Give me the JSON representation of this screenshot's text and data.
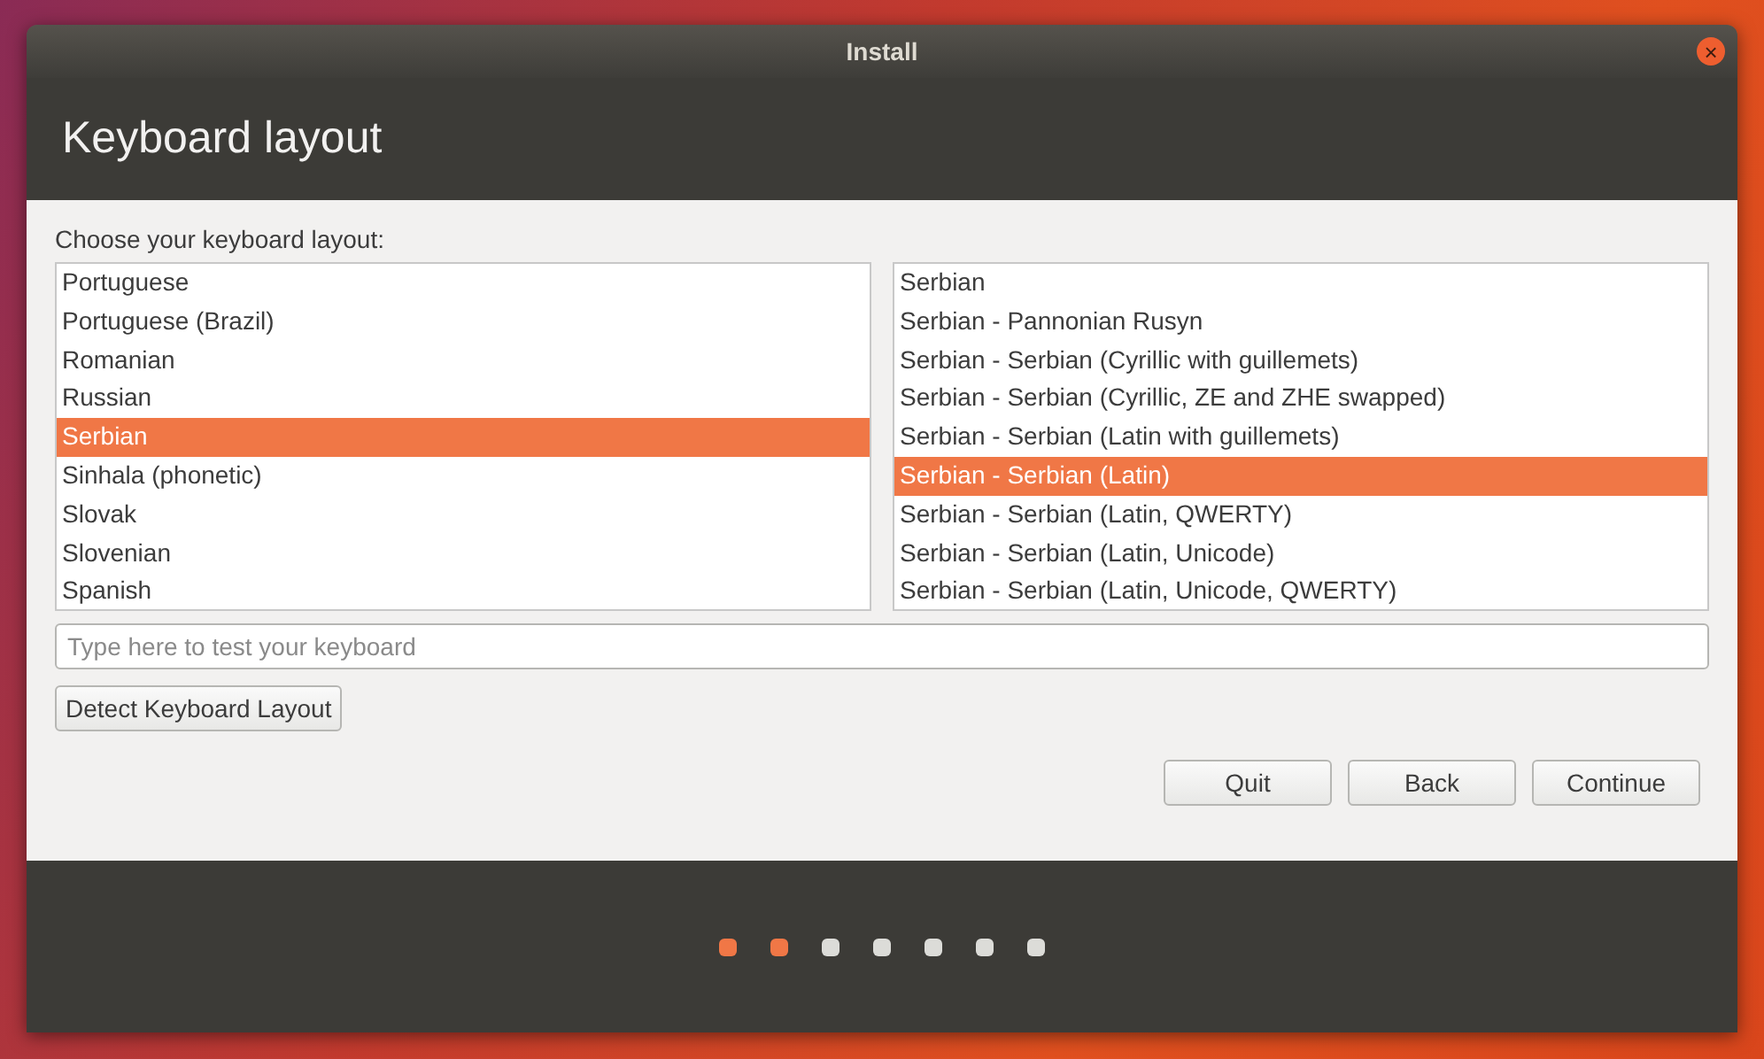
{
  "window": {
    "title": "Install",
    "close": "×"
  },
  "heading": "Keyboard layout",
  "prompt": "Choose your keyboard layout:",
  "layouts": [
    {
      "label": "Portuguese",
      "selected": false
    },
    {
      "label": "Portuguese (Brazil)",
      "selected": false
    },
    {
      "label": "Romanian",
      "selected": false
    },
    {
      "label": "Russian",
      "selected": false
    },
    {
      "label": "Serbian",
      "selected": true
    },
    {
      "label": "Sinhala (phonetic)",
      "selected": false
    },
    {
      "label": "Slovak",
      "selected": false
    },
    {
      "label": "Slovenian",
      "selected": false
    },
    {
      "label": "Spanish",
      "selected": false
    }
  ],
  "variants": [
    {
      "label": "Serbian",
      "selected": false
    },
    {
      "label": "Serbian - Pannonian Rusyn",
      "selected": false
    },
    {
      "label": "Serbian - Serbian (Cyrillic with guillemets)",
      "selected": false
    },
    {
      "label": "Serbian - Serbian (Cyrillic, ZE and ZHE swapped)",
      "selected": false
    },
    {
      "label": "Serbian - Serbian (Latin with guillemets)",
      "selected": false
    },
    {
      "label": "Serbian - Serbian (Latin)",
      "selected": true
    },
    {
      "label": "Serbian - Serbian (Latin, QWERTY)",
      "selected": false
    },
    {
      "label": "Serbian - Serbian (Latin, Unicode)",
      "selected": false
    },
    {
      "label": "Serbian - Serbian (Latin, Unicode, QWERTY)",
      "selected": false
    }
  ],
  "test_field": {
    "placeholder": "Type here to test your keyboard"
  },
  "detect_button": "Detect Keyboard Layout",
  "buttons": [
    "Quit",
    "Back",
    "Continue"
  ],
  "progress": [
    {
      "done": true
    },
    {
      "done": true
    },
    {
      "done": false
    },
    {
      "done": false
    },
    {
      "done": false
    },
    {
      "done": false
    },
    {
      "done": false
    }
  ]
}
